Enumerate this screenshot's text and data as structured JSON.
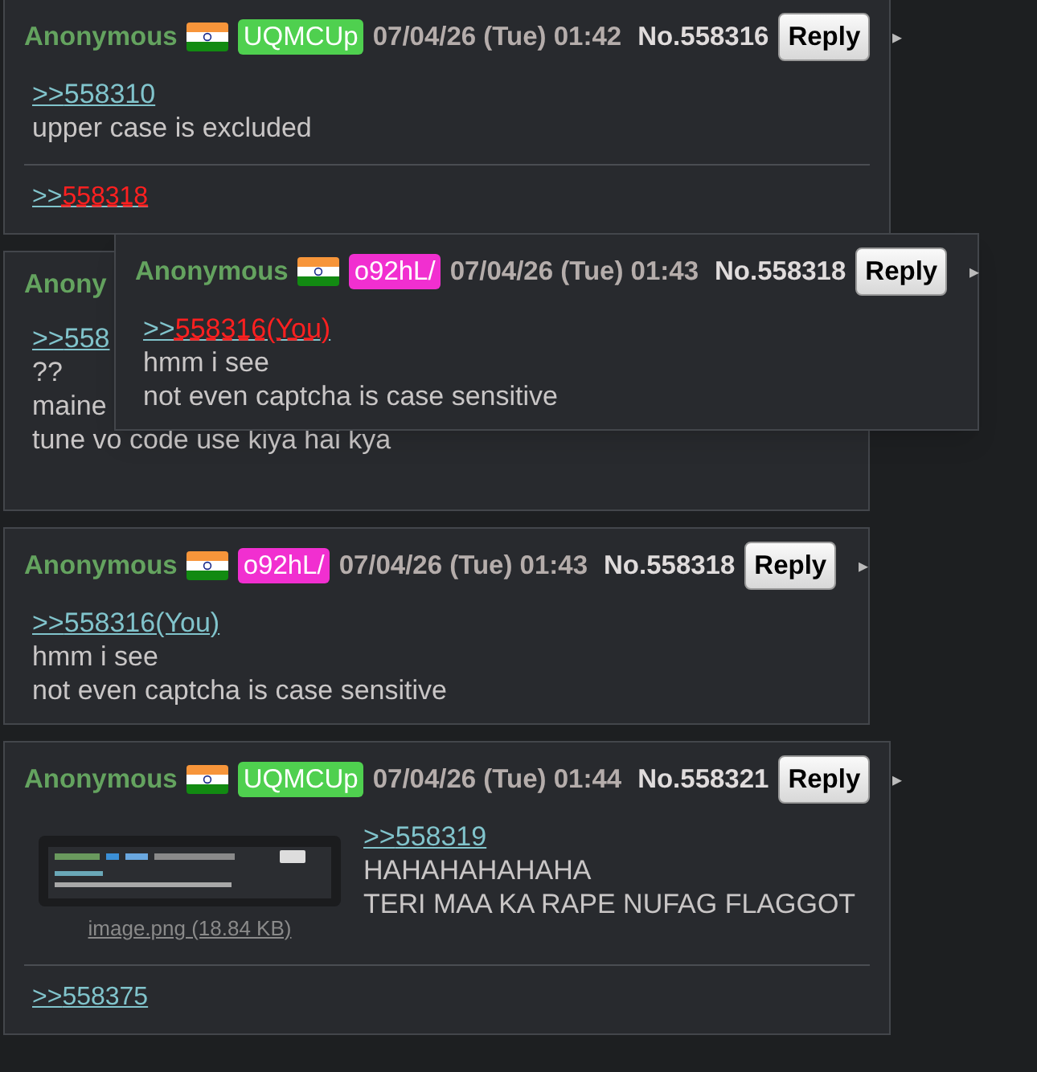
{
  "posts": [
    {
      "name": "Anonymous",
      "id": {
        "text": "UQMCUp",
        "color": "#4fd04f"
      },
      "date": "07/04/26 (Tue) 01:42",
      "number": "No.558316",
      "reply": "Reply",
      "menu": "▸",
      "quote": {
        "arrows": ">>",
        "target": "558310",
        "highlighted": false
      },
      "lines": [
        "upper case is excluded"
      ],
      "backlinks": [
        {
          "arrows": ">>",
          "target": "558318",
          "highlighted": true
        }
      ]
    },
    {
      "name": "Anony",
      "quote": {
        "arrows": ">>",
        "target": "558",
        "highlighted": false
      },
      "lines": [
        "??",
        "maine",
        "tune vo code use kiya hai kya"
      ]
    },
    {
      "name": "Anonymous",
      "id": {
        "text": "o92hL/",
        "color": "#f12fd0"
      },
      "date": "07/04/26 (Tue) 01:43",
      "number": "No.558318",
      "reply": "Reply",
      "menu": "▸",
      "quote": {
        "arrows": ">>",
        "target": "558316(You)",
        "highlighted": false
      },
      "lines": [
        "hmm i see",
        "not even captcha is case sensitive"
      ]
    },
    {
      "name": "Anonymous",
      "id": {
        "text": "UQMCUp",
        "color": "#4fd04f"
      },
      "date": "07/04/26 (Tue) 01:44",
      "number": "No.558321",
      "reply": "Reply",
      "menu": "▸",
      "file": {
        "kind": "picture",
        "label": "image.png (18.84 KB)"
      },
      "quote": {
        "arrows": ">>",
        "target": "558319",
        "highlighted": false
      },
      "lines": [
        "HAHAHAHAHAHA",
        "TERI MAA KA RAPE NUFAG FLAGGOT"
      ],
      "backlinks": [
        {
          "arrows": ">>",
          "target": "558375",
          "highlighted": false
        }
      ]
    }
  ],
  "popup": {
    "name": "Anonymous",
    "id": {
      "text": "o92hL/",
      "color": "#f12fd0"
    },
    "date": "07/04/26 (Tue) 01:43",
    "number": "No.558318",
    "reply": "Reply",
    "menu": "▸",
    "quote": {
      "arrows": ">>",
      "target": "558316(You)",
      "highlighted": true
    },
    "lines": [
      "hmm i see",
      "not even captcha is case sensitive"
    ]
  }
}
